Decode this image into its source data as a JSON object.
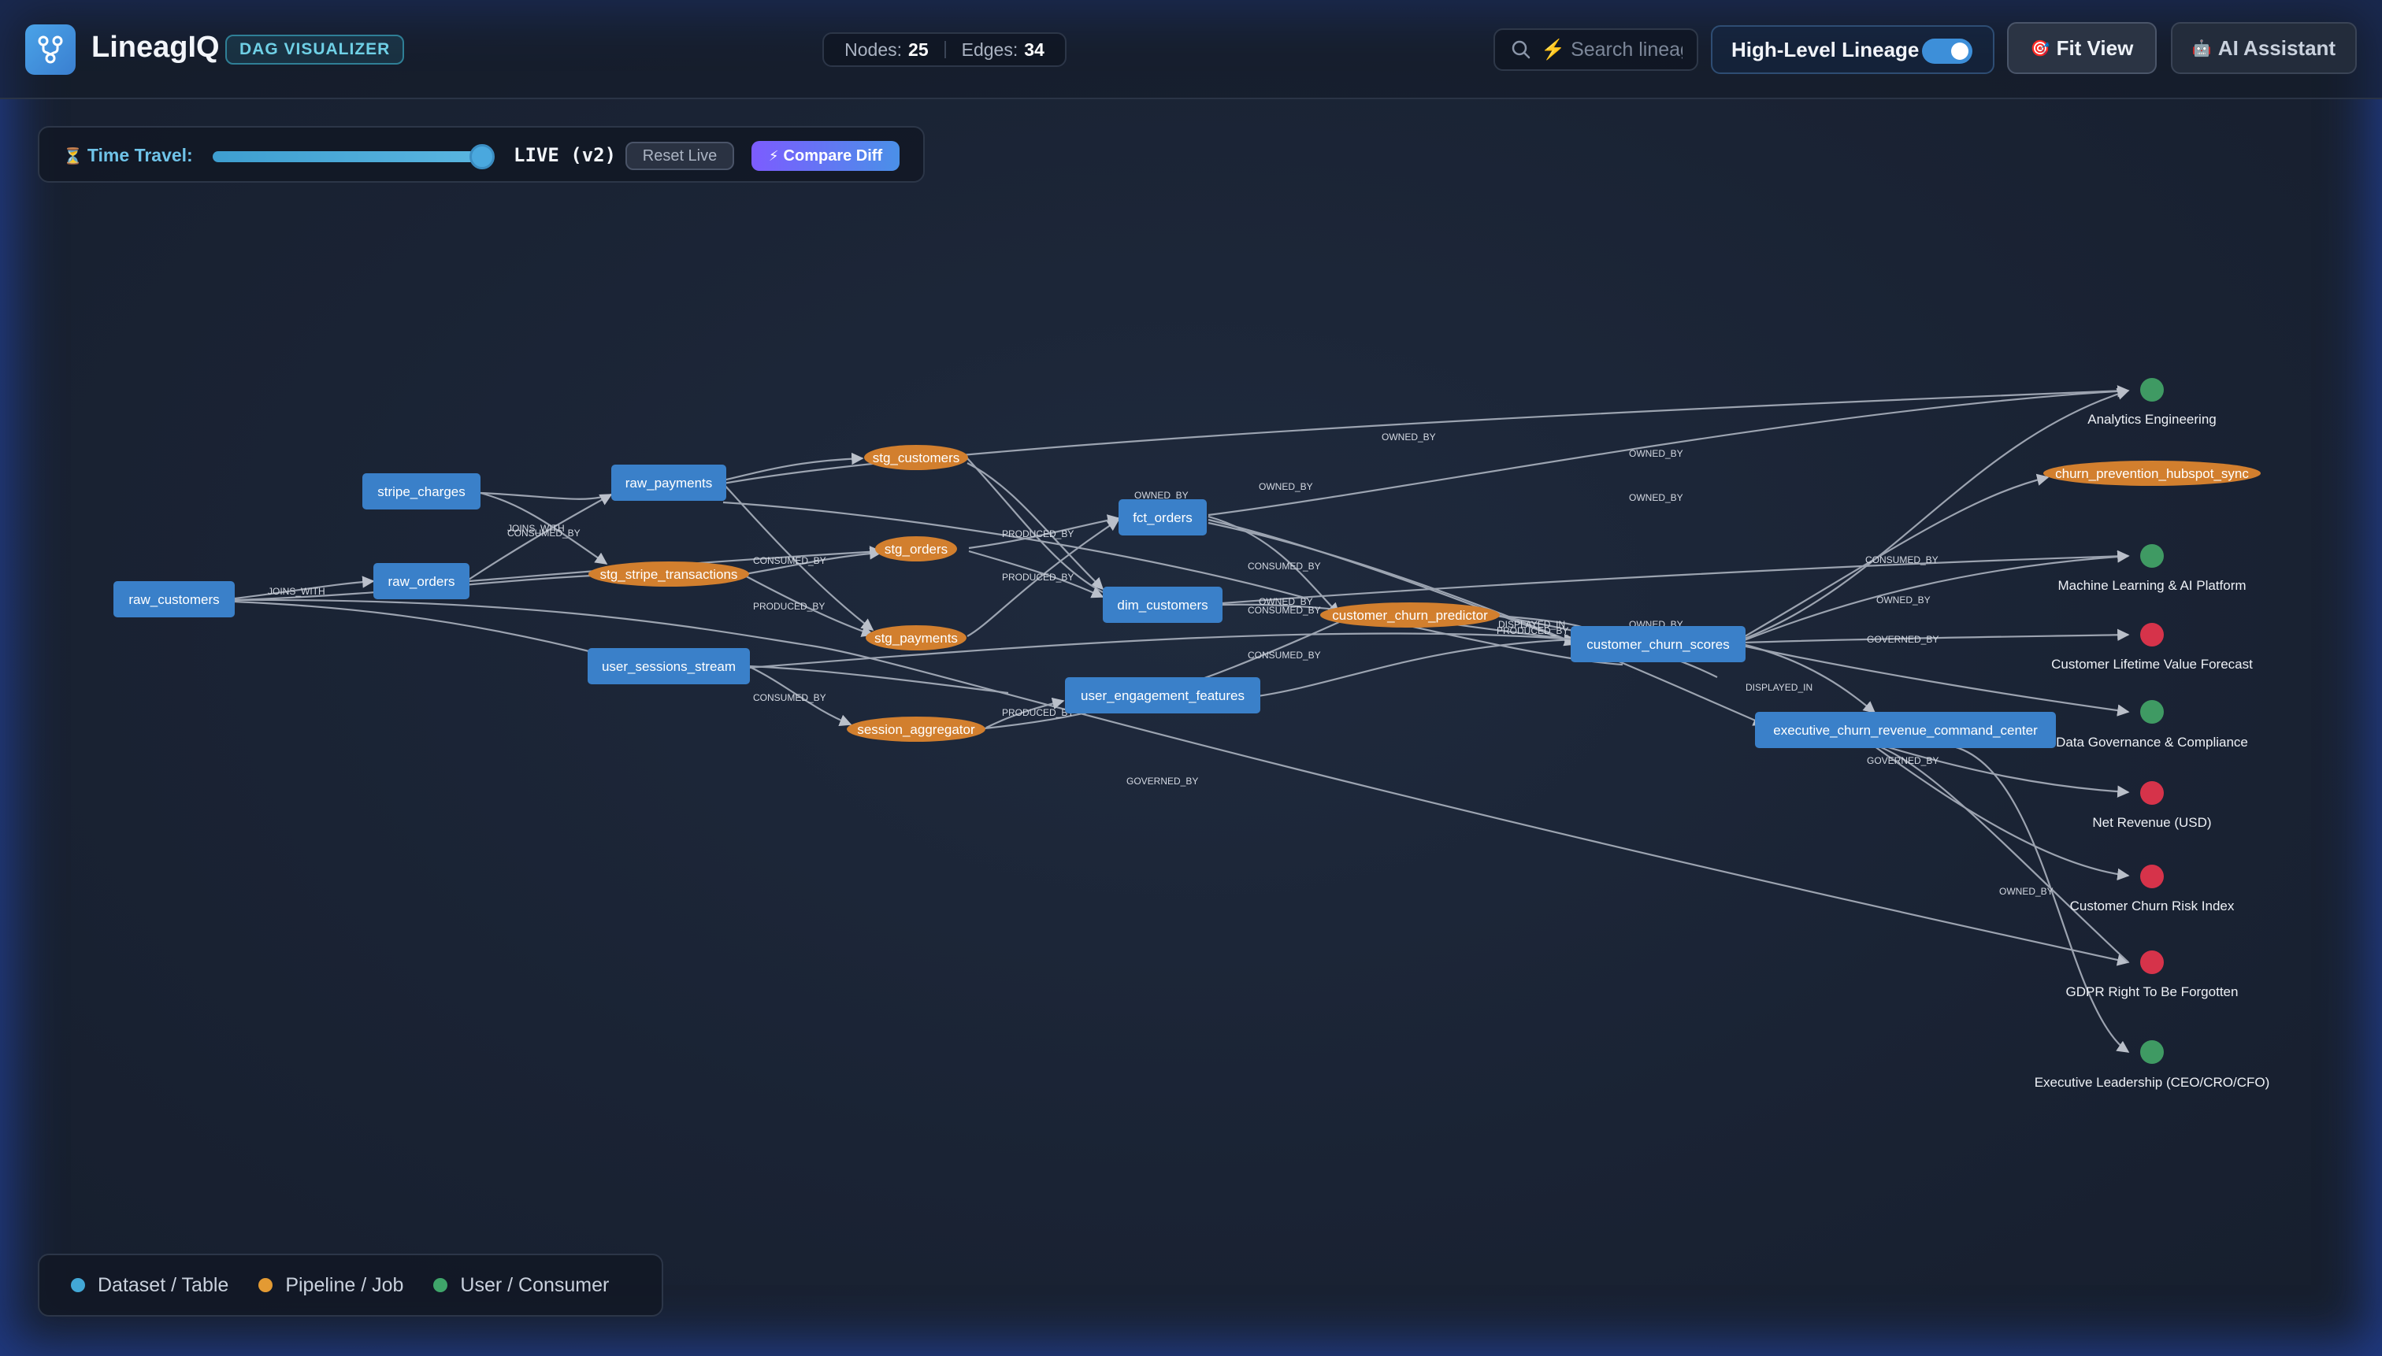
{
  "app": {
    "name": "LineagIQ",
    "badge": "DAG VISUALIZER"
  },
  "stats": {
    "nodes_label": "Nodes:",
    "nodes_value": "25",
    "edges_label": "Edges:",
    "edges_value": "34"
  },
  "search": {
    "placeholder": "⚡ Search lineage..."
  },
  "toolbar": {
    "lineage_label": "High-Level Lineage",
    "lineage_on": true,
    "fit_label": "Fit View",
    "ai_label": "AI Assistant"
  },
  "timetravel": {
    "label": "Time Travel:",
    "position_fraction": 1.0,
    "status": "LIVE (v2)",
    "reset_label": "Reset Live",
    "compare_label": "Compare Diff"
  },
  "colors": {
    "dataset": "#3a80c9",
    "pipeline": "#d27f2e",
    "consumer_green": "#3f9a63",
    "consumer_red": "#d6334a",
    "edge": "#b8bfcb",
    "accent": "#4aa8de"
  },
  "nodes": {
    "raw_customers": "raw_customers",
    "raw_orders": "raw_orders",
    "stripe_charges": "stripe_charges",
    "raw_payments": "raw_payments",
    "user_sessions_stream": "user_sessions_stream",
    "stg_customers": "stg_customers",
    "stg_orders": "stg_orders",
    "stg_stripe_transactions": "stg_stripe_transactions",
    "stg_payments": "stg_payments",
    "session_aggregator": "session_aggregator",
    "fct_orders": "fct_orders",
    "dim_customers": "dim_customers",
    "user_engagement_features": "user_engagement_features",
    "customer_churn_predictor": "customer_churn_predictor",
    "customer_churn_scores": "customer_churn_scores",
    "executive_churn_revenue_command_center": "executive_churn_revenue_command_center",
    "churn_prevention_hubspot_sync": "churn_prevention_hubspot_sync",
    "analytics_engineering": "Analytics Engineering",
    "ml_ai_platform": "Machine Learning & AI Platform",
    "customer_lifetime_value": "Customer Lifetime Value Forecast",
    "data_governance": "Data Governance & Compliance",
    "net_revenue": "Net Revenue (USD)",
    "churn_risk_index": "Customer Churn Risk Index",
    "gdpr": "GDPR Right To Be Forgotten",
    "executive_leadership": "Executive Leadership (CEO/CRO/CFO)"
  },
  "edge_labels": {
    "joins_with": "JOINS_WITH",
    "joins_with_2": "JOINS_WITH",
    "consumed_by_a": "CONSUMED_BY",
    "consumed_by_b": "CONSUMED_BY",
    "consumed_by_c": "CONSUMED_BY",
    "consumed_by_d": "CONSUMED_BY",
    "consumed_by_e": "CONSUMED_BY",
    "consumed_by_f": "CONSUMED_BY",
    "consumed_by_g": "CONSUMED_BY",
    "consumed_by_h": "CONSUMED_BY",
    "produced_by_a": "PRODUCED_BY",
    "produced_by_b": "PRODUCED_BY",
    "produced_by_c": "PRODUCED_BY",
    "produced_by_d": "PRODUCED_BY",
    "produced_by_e": "PRODUCED_BY",
    "owned_by_a": "OWNED_BY",
    "owned_by_b": "OWNED_BY",
    "owned_by_c": "OWNED_BY",
    "owned_by_d": "OWNED_BY",
    "owned_by_e": "OWNED_BY",
    "owned_by_f": "OWNED_BY",
    "owned_by_g": "OWNED_BY",
    "owned_by_h": "OWNED_BY",
    "displayed_in_a": "DISPLAYED_IN",
    "displayed_in_b": "DISPLAYED_IN",
    "governed_by_a": "GOVERNED_BY",
    "governed_by_b": "GOVERNED_BY",
    "governed_by_c": "GOVERNED_BY"
  },
  "legend": {
    "dataset": "Dataset / Table",
    "pipeline": "Pipeline / Job",
    "consumer": "User / Consumer"
  }
}
